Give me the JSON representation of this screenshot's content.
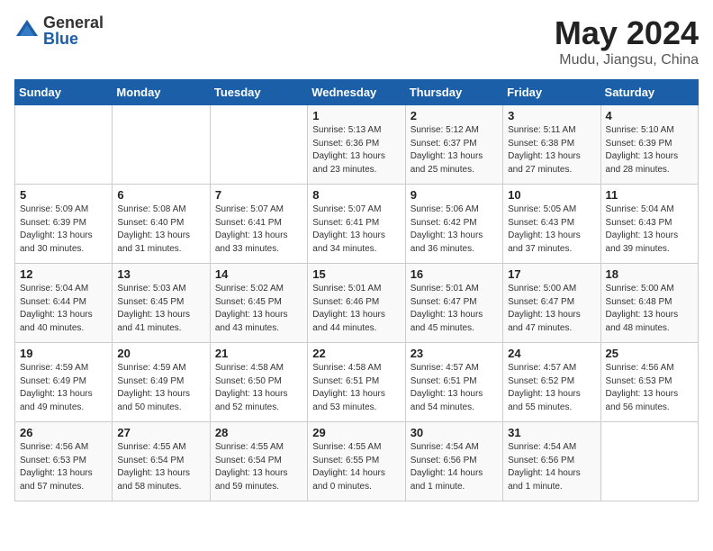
{
  "header": {
    "logo_general": "General",
    "logo_blue": "Blue",
    "title": "May 2024",
    "subtitle": "Mudu, Jiangsu, China"
  },
  "days_of_week": [
    "Sunday",
    "Monday",
    "Tuesday",
    "Wednesday",
    "Thursday",
    "Friday",
    "Saturday"
  ],
  "weeks": [
    [
      {
        "day": "",
        "info": ""
      },
      {
        "day": "",
        "info": ""
      },
      {
        "day": "",
        "info": ""
      },
      {
        "day": "1",
        "info": "Sunrise: 5:13 AM\nSunset: 6:36 PM\nDaylight: 13 hours\nand 23 minutes."
      },
      {
        "day": "2",
        "info": "Sunrise: 5:12 AM\nSunset: 6:37 PM\nDaylight: 13 hours\nand 25 minutes."
      },
      {
        "day": "3",
        "info": "Sunrise: 5:11 AM\nSunset: 6:38 PM\nDaylight: 13 hours\nand 27 minutes."
      },
      {
        "day": "4",
        "info": "Sunrise: 5:10 AM\nSunset: 6:39 PM\nDaylight: 13 hours\nand 28 minutes."
      }
    ],
    [
      {
        "day": "5",
        "info": "Sunrise: 5:09 AM\nSunset: 6:39 PM\nDaylight: 13 hours\nand 30 minutes."
      },
      {
        "day": "6",
        "info": "Sunrise: 5:08 AM\nSunset: 6:40 PM\nDaylight: 13 hours\nand 31 minutes."
      },
      {
        "day": "7",
        "info": "Sunrise: 5:07 AM\nSunset: 6:41 PM\nDaylight: 13 hours\nand 33 minutes."
      },
      {
        "day": "8",
        "info": "Sunrise: 5:07 AM\nSunset: 6:41 PM\nDaylight: 13 hours\nand 34 minutes."
      },
      {
        "day": "9",
        "info": "Sunrise: 5:06 AM\nSunset: 6:42 PM\nDaylight: 13 hours\nand 36 minutes."
      },
      {
        "day": "10",
        "info": "Sunrise: 5:05 AM\nSunset: 6:43 PM\nDaylight: 13 hours\nand 37 minutes."
      },
      {
        "day": "11",
        "info": "Sunrise: 5:04 AM\nSunset: 6:43 PM\nDaylight: 13 hours\nand 39 minutes."
      }
    ],
    [
      {
        "day": "12",
        "info": "Sunrise: 5:04 AM\nSunset: 6:44 PM\nDaylight: 13 hours\nand 40 minutes."
      },
      {
        "day": "13",
        "info": "Sunrise: 5:03 AM\nSunset: 6:45 PM\nDaylight: 13 hours\nand 41 minutes."
      },
      {
        "day": "14",
        "info": "Sunrise: 5:02 AM\nSunset: 6:45 PM\nDaylight: 13 hours\nand 43 minutes."
      },
      {
        "day": "15",
        "info": "Sunrise: 5:01 AM\nSunset: 6:46 PM\nDaylight: 13 hours\nand 44 minutes."
      },
      {
        "day": "16",
        "info": "Sunrise: 5:01 AM\nSunset: 6:47 PM\nDaylight: 13 hours\nand 45 minutes."
      },
      {
        "day": "17",
        "info": "Sunrise: 5:00 AM\nSunset: 6:47 PM\nDaylight: 13 hours\nand 47 minutes."
      },
      {
        "day": "18",
        "info": "Sunrise: 5:00 AM\nSunset: 6:48 PM\nDaylight: 13 hours\nand 48 minutes."
      }
    ],
    [
      {
        "day": "19",
        "info": "Sunrise: 4:59 AM\nSunset: 6:49 PM\nDaylight: 13 hours\nand 49 minutes."
      },
      {
        "day": "20",
        "info": "Sunrise: 4:59 AM\nSunset: 6:49 PM\nDaylight: 13 hours\nand 50 minutes."
      },
      {
        "day": "21",
        "info": "Sunrise: 4:58 AM\nSunset: 6:50 PM\nDaylight: 13 hours\nand 52 minutes."
      },
      {
        "day": "22",
        "info": "Sunrise: 4:58 AM\nSunset: 6:51 PM\nDaylight: 13 hours\nand 53 minutes."
      },
      {
        "day": "23",
        "info": "Sunrise: 4:57 AM\nSunset: 6:51 PM\nDaylight: 13 hours\nand 54 minutes."
      },
      {
        "day": "24",
        "info": "Sunrise: 4:57 AM\nSunset: 6:52 PM\nDaylight: 13 hours\nand 55 minutes."
      },
      {
        "day": "25",
        "info": "Sunrise: 4:56 AM\nSunset: 6:53 PM\nDaylight: 13 hours\nand 56 minutes."
      }
    ],
    [
      {
        "day": "26",
        "info": "Sunrise: 4:56 AM\nSunset: 6:53 PM\nDaylight: 13 hours\nand 57 minutes."
      },
      {
        "day": "27",
        "info": "Sunrise: 4:55 AM\nSunset: 6:54 PM\nDaylight: 13 hours\nand 58 minutes."
      },
      {
        "day": "28",
        "info": "Sunrise: 4:55 AM\nSunset: 6:54 PM\nDaylight: 13 hours\nand 59 minutes."
      },
      {
        "day": "29",
        "info": "Sunrise: 4:55 AM\nSunset: 6:55 PM\nDaylight: 14 hours\nand 0 minutes."
      },
      {
        "day": "30",
        "info": "Sunrise: 4:54 AM\nSunset: 6:56 PM\nDaylight: 14 hours\nand 1 minute."
      },
      {
        "day": "31",
        "info": "Sunrise: 4:54 AM\nSunset: 6:56 PM\nDaylight: 14 hours\nand 1 minute."
      },
      {
        "day": "",
        "info": ""
      }
    ]
  ]
}
